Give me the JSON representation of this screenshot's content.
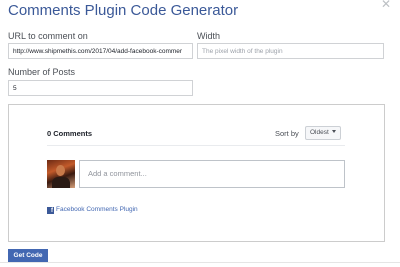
{
  "dialog": {
    "title": "Comments Plugin Code Generator",
    "close_icon": "close-icon"
  },
  "form": {
    "url_label": "URL to comment on",
    "url_value": "http://www.shipmethis.com/2017/04/add-facebook-commer",
    "width_label": "Width",
    "width_placeholder": "The pixel width of the plugin",
    "posts_label": "Number of Posts",
    "posts_value": "5"
  },
  "preview": {
    "comment_count": "0 Comments",
    "sort_label": "Sort by",
    "sort_selected": "Oldest",
    "comment_placeholder": "Add a comment...",
    "plugin_link": "Facebook Comments Plugin"
  },
  "actions": {
    "get_code_label": "Get Code"
  },
  "colors": {
    "title": "#3b5998",
    "button": "#4267b2",
    "link": "#4267b2"
  }
}
